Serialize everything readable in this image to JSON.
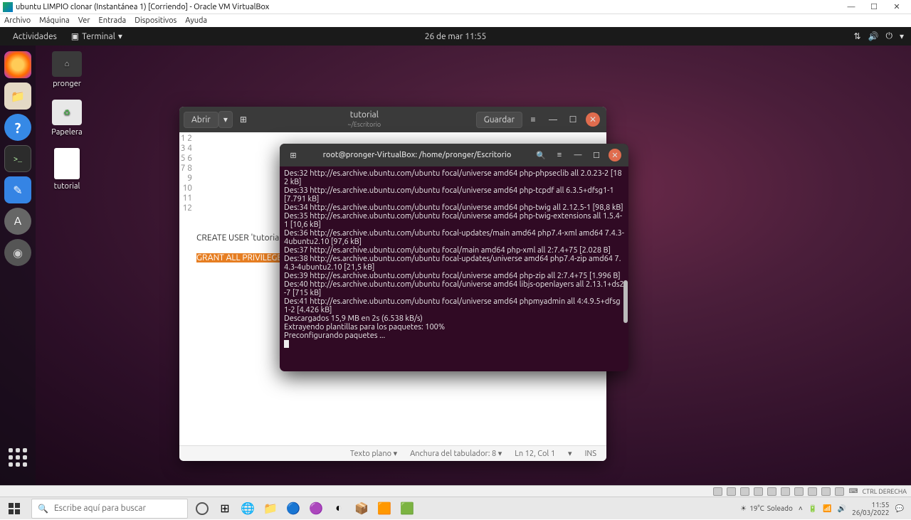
{
  "vbox": {
    "title": "ubuntu LIMPIO clonar (Instantánea 1) [Corriendo] - Oracle VM VirtualBox",
    "menu": [
      "Archivo",
      "Máquina",
      "Ver",
      "Entrada",
      "Dispositivos",
      "Ayuda"
    ],
    "ctrl_key": "CTRL DERECHA"
  },
  "topbar": {
    "activities": "Actividades",
    "app": "Terminal",
    "clock": "26 de mar   11:55"
  },
  "desktop": {
    "home": "pronger",
    "trash": "Papelera",
    "file": "tutorial"
  },
  "gedit": {
    "open": "Abrir",
    "save": "Guardar",
    "title": "tutorial",
    "subtitle": "~/Escritorio",
    "line_numbers": [
      "1",
      "2",
      "3",
      "4",
      "5",
      "6",
      "7",
      "8",
      "9",
      "10",
      "11",
      "12"
    ],
    "line10": "CREATE USER 'tutorial",
    "line12_hl": "GRANT ALL PRIVILEGES",
    "status_plain": "Texto plano ▾",
    "status_tab": "Anchura del tabulador: 8 ▾",
    "status_pos": "Ln 12, Col 1",
    "status_ins": "INS"
  },
  "terminal": {
    "title": "root@pronger-VirtualBox: /home/pronger/Escritorio",
    "lines": [
      "Des:32 http://es.archive.ubuntu.com/ubuntu focal/universe amd64 php-phpseclib all 2.0.23-2 [182 kB]",
      "Des:33 http://es.archive.ubuntu.com/ubuntu focal/universe amd64 php-tcpdf all 6.3.5+dfsg1-1 [7.791 kB]",
      "Des:34 http://es.archive.ubuntu.com/ubuntu focal/universe amd64 php-twig all 2.12.5-1 [98,8 kB]",
      "Des:35 http://es.archive.ubuntu.com/ubuntu focal/universe amd64 php-twig-extensions all 1.5.4-1 [10,6 kB]",
      "Des:36 http://es.archive.ubuntu.com/ubuntu focal-updates/main amd64 php7.4-xml amd64 7.4.3-4ubuntu2.10 [97,6 kB]",
      "Des:37 http://es.archive.ubuntu.com/ubuntu focal/main amd64 php-xml all 2:7.4+75 [2.028 B]",
      "Des:38 http://es.archive.ubuntu.com/ubuntu focal-updates/universe amd64 php7.4-zip amd64 7.4.3-4ubuntu2.10 [21,5 kB]",
      "Des:39 http://es.archive.ubuntu.com/ubuntu focal/universe amd64 php-zip all 2:7.4+75 [1.996 B]",
      "Des:40 http://es.archive.ubuntu.com/ubuntu focal/universe amd64 libjs-openlayers all 2.13.1+ds2-7 [715 kB]",
      "Des:41 http://es.archive.ubuntu.com/ubuntu focal/universe amd64 phpmyadmin all 4:4.9.5+dfsg1-2 [4.426 kB]",
      "Descargados 15,9 MB en 2s (6.538 kB/s)",
      "Extrayendo plantillas para los paquetes: 100%",
      "Preconfigurando paquetes ..."
    ]
  },
  "taskbar": {
    "search_placeholder": "Escribe aquí para buscar",
    "weather_temp": "19°C",
    "weather_cond": "Soleado",
    "time": "11:55",
    "date": "26/03/2022"
  }
}
